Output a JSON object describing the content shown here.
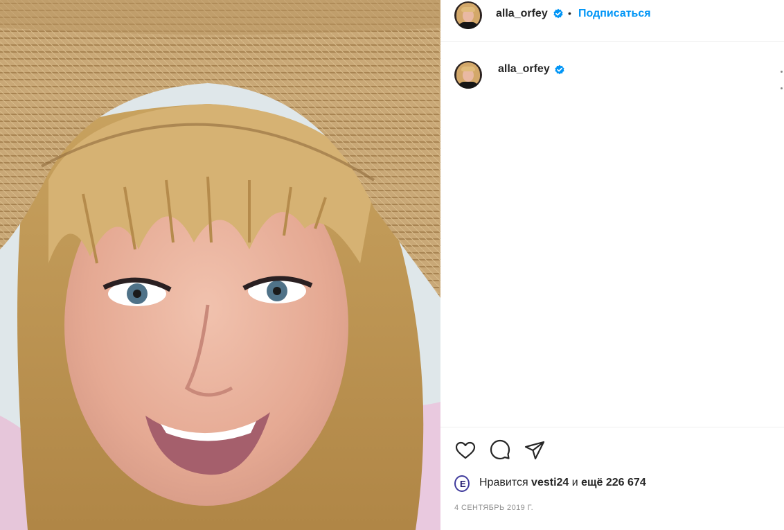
{
  "post": {
    "username": "alla_orfey",
    "verified": true,
    "separator": "•",
    "follow_label": "Подписаться",
    "icons": {
      "like": "heart-icon",
      "comment": "comment-icon",
      "share": "paper-plane-icon",
      "verified": "verified-badge-icon"
    },
    "likes": {
      "prefix": "Нравится ",
      "first_liker": "vesti24",
      "middle": " и ",
      "others": "ещё 226 674"
    },
    "date": "4 СЕНТЯБРЬ 2019 Г."
  },
  "colors": {
    "accent": "#0095f6",
    "verified": "#0095f6",
    "text": "#262626",
    "muted": "#8e8e8e",
    "divider": "#efefef"
  }
}
